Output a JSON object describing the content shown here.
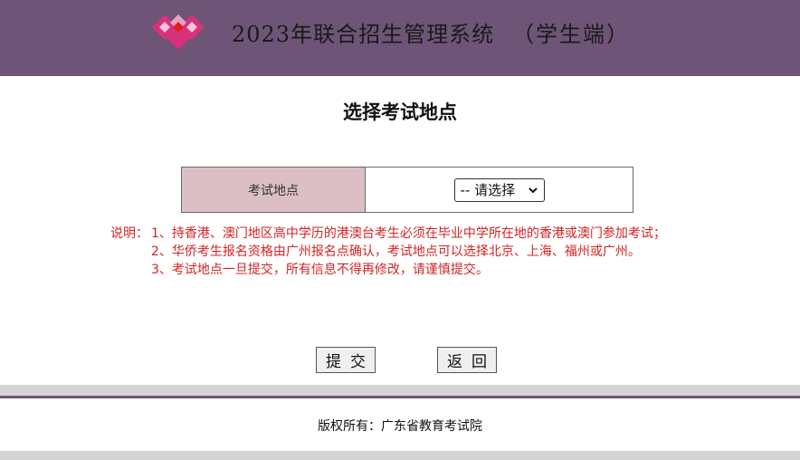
{
  "header": {
    "title": "2023年联合招生管理系统",
    "subtitle": "（学生端）",
    "background_color": "#6e5477",
    "logo_icon": "diamond-logo-icon"
  },
  "page": {
    "title": "选择考试地点"
  },
  "form": {
    "label": "考试地点",
    "select": {
      "selected_value": "-- 请选择",
      "icon": "chevron-down-icon"
    }
  },
  "notes": {
    "prefix": "说明：",
    "lines": [
      "1、持香港、澳门地区高中学历的港澳台考生必须在毕业中学所在地的香港或澳门参加考试；",
      "2、华侨考生报名资格由广州报名点确认，考试地点可以选择北京、上海、福州或广州。",
      "3、考试地点一旦提交，所有信息不得再修改，请谨慎提交。"
    ],
    "color": "#d42323"
  },
  "buttons": {
    "submit_label": "提交",
    "back_label": "返回"
  },
  "footer": {
    "copyright": "版权所有：广东省教育考试院"
  }
}
